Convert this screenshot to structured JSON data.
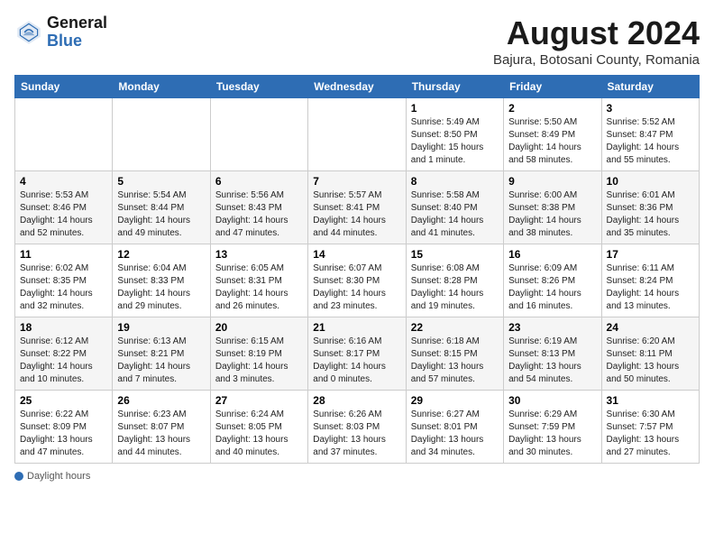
{
  "header": {
    "logo_general": "General",
    "logo_blue": "Blue",
    "month_year": "August 2024",
    "location": "Bajura, Botosani County, Romania"
  },
  "days_of_week": [
    "Sunday",
    "Monday",
    "Tuesday",
    "Wednesday",
    "Thursday",
    "Friday",
    "Saturday"
  ],
  "weeks": [
    [
      {
        "day": "",
        "info": ""
      },
      {
        "day": "",
        "info": ""
      },
      {
        "day": "",
        "info": ""
      },
      {
        "day": "",
        "info": ""
      },
      {
        "day": "1",
        "info": "Sunrise: 5:49 AM\nSunset: 8:50 PM\nDaylight: 15 hours and 1 minute."
      },
      {
        "day": "2",
        "info": "Sunrise: 5:50 AM\nSunset: 8:49 PM\nDaylight: 14 hours and 58 minutes."
      },
      {
        "day": "3",
        "info": "Sunrise: 5:52 AM\nSunset: 8:47 PM\nDaylight: 14 hours and 55 minutes."
      }
    ],
    [
      {
        "day": "4",
        "info": "Sunrise: 5:53 AM\nSunset: 8:46 PM\nDaylight: 14 hours and 52 minutes."
      },
      {
        "day": "5",
        "info": "Sunrise: 5:54 AM\nSunset: 8:44 PM\nDaylight: 14 hours and 49 minutes."
      },
      {
        "day": "6",
        "info": "Sunrise: 5:56 AM\nSunset: 8:43 PM\nDaylight: 14 hours and 47 minutes."
      },
      {
        "day": "7",
        "info": "Sunrise: 5:57 AM\nSunset: 8:41 PM\nDaylight: 14 hours and 44 minutes."
      },
      {
        "day": "8",
        "info": "Sunrise: 5:58 AM\nSunset: 8:40 PM\nDaylight: 14 hours and 41 minutes."
      },
      {
        "day": "9",
        "info": "Sunrise: 6:00 AM\nSunset: 8:38 PM\nDaylight: 14 hours and 38 minutes."
      },
      {
        "day": "10",
        "info": "Sunrise: 6:01 AM\nSunset: 8:36 PM\nDaylight: 14 hours and 35 minutes."
      }
    ],
    [
      {
        "day": "11",
        "info": "Sunrise: 6:02 AM\nSunset: 8:35 PM\nDaylight: 14 hours and 32 minutes."
      },
      {
        "day": "12",
        "info": "Sunrise: 6:04 AM\nSunset: 8:33 PM\nDaylight: 14 hours and 29 minutes."
      },
      {
        "day": "13",
        "info": "Sunrise: 6:05 AM\nSunset: 8:31 PM\nDaylight: 14 hours and 26 minutes."
      },
      {
        "day": "14",
        "info": "Sunrise: 6:07 AM\nSunset: 8:30 PM\nDaylight: 14 hours and 23 minutes."
      },
      {
        "day": "15",
        "info": "Sunrise: 6:08 AM\nSunset: 8:28 PM\nDaylight: 14 hours and 19 minutes."
      },
      {
        "day": "16",
        "info": "Sunrise: 6:09 AM\nSunset: 8:26 PM\nDaylight: 14 hours and 16 minutes."
      },
      {
        "day": "17",
        "info": "Sunrise: 6:11 AM\nSunset: 8:24 PM\nDaylight: 14 hours and 13 minutes."
      }
    ],
    [
      {
        "day": "18",
        "info": "Sunrise: 6:12 AM\nSunset: 8:22 PM\nDaylight: 14 hours and 10 minutes."
      },
      {
        "day": "19",
        "info": "Sunrise: 6:13 AM\nSunset: 8:21 PM\nDaylight: 14 hours and 7 minutes."
      },
      {
        "day": "20",
        "info": "Sunrise: 6:15 AM\nSunset: 8:19 PM\nDaylight: 14 hours and 3 minutes."
      },
      {
        "day": "21",
        "info": "Sunrise: 6:16 AM\nSunset: 8:17 PM\nDaylight: 14 hours and 0 minutes."
      },
      {
        "day": "22",
        "info": "Sunrise: 6:18 AM\nSunset: 8:15 PM\nDaylight: 13 hours and 57 minutes."
      },
      {
        "day": "23",
        "info": "Sunrise: 6:19 AM\nSunset: 8:13 PM\nDaylight: 13 hours and 54 minutes."
      },
      {
        "day": "24",
        "info": "Sunrise: 6:20 AM\nSunset: 8:11 PM\nDaylight: 13 hours and 50 minutes."
      }
    ],
    [
      {
        "day": "25",
        "info": "Sunrise: 6:22 AM\nSunset: 8:09 PM\nDaylight: 13 hours and 47 minutes."
      },
      {
        "day": "26",
        "info": "Sunrise: 6:23 AM\nSunset: 8:07 PM\nDaylight: 13 hours and 44 minutes."
      },
      {
        "day": "27",
        "info": "Sunrise: 6:24 AM\nSunset: 8:05 PM\nDaylight: 13 hours and 40 minutes."
      },
      {
        "day": "28",
        "info": "Sunrise: 6:26 AM\nSunset: 8:03 PM\nDaylight: 13 hours and 37 minutes."
      },
      {
        "day": "29",
        "info": "Sunrise: 6:27 AM\nSunset: 8:01 PM\nDaylight: 13 hours and 34 minutes."
      },
      {
        "day": "30",
        "info": "Sunrise: 6:29 AM\nSunset: 7:59 PM\nDaylight: 13 hours and 30 minutes."
      },
      {
        "day": "31",
        "info": "Sunrise: 6:30 AM\nSunset: 7:57 PM\nDaylight: 13 hours and 27 minutes."
      }
    ]
  ],
  "footer": {
    "daylight_label": "Daylight hours"
  }
}
